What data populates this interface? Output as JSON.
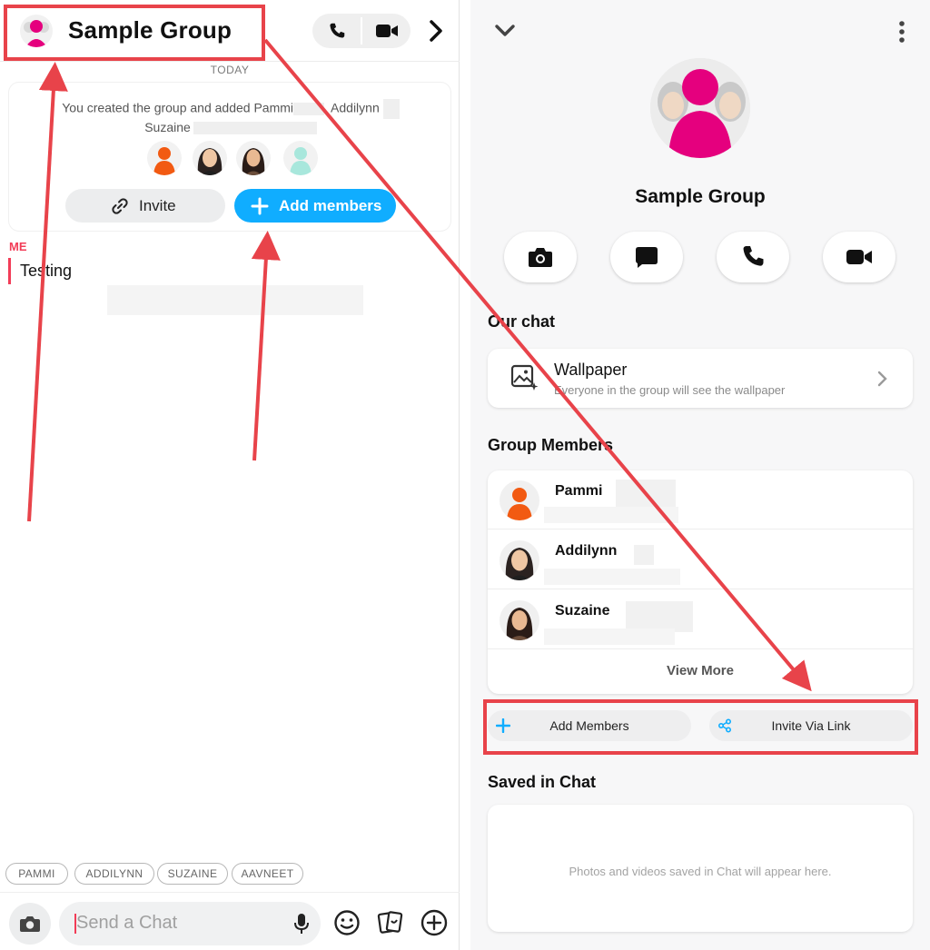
{
  "left": {
    "header": {
      "title": "Sample Group",
      "call_icon": "phone-icon",
      "video_icon": "video-camera-icon",
      "next_icon": "chevron-right-icon"
    },
    "date_divider": "TODAY",
    "created_card": {
      "line1": "You created the group and added Pammi",
      "line1_rest": ", Addilynn",
      "line2": "Suzaine",
      "invite_label": "Invite",
      "add_members_label": "Add members"
    },
    "message": {
      "sender": "ME",
      "text": "Testing"
    },
    "mention_chips": [
      "PAMMI",
      "ADDILYNN",
      "SUZAINE",
      "AAVNEET"
    ],
    "composer": {
      "placeholder": "Send a Chat",
      "camera_icon": "camera-icon",
      "mic_icon": "microphone-icon",
      "emoji_icon": "smiley-icon",
      "sticker_icon": "sticker-cards-icon",
      "plus_icon": "plus-circle-icon"
    }
  },
  "right": {
    "group_name": "Sample Group",
    "actions": [
      "camera-icon",
      "chat-bubble-icon",
      "phone-icon",
      "video-camera-icon"
    ],
    "our_chat_title": "Our chat",
    "wallpaper": {
      "title": "Wallpaper",
      "subtitle": "Everyone in the group will see the wallpaper"
    },
    "group_members_title": "Group Members",
    "members": [
      {
        "name": "Pammi"
      },
      {
        "name": "Addilynn"
      },
      {
        "name": "Suzaine"
      }
    ],
    "view_more": "View More",
    "add_members_label": "Add Members",
    "invite_link_label": "Invite Via Link",
    "saved_title": "Saved in Chat",
    "saved_empty": "Photos and videos saved in Chat will appear here."
  },
  "colors": {
    "accent_blue": "#10adff",
    "snap_red": "#f23c57",
    "annotation_red": "#e8434a",
    "group_magenta": "#e5007e",
    "bitmoji_orange": "#f25a12"
  }
}
